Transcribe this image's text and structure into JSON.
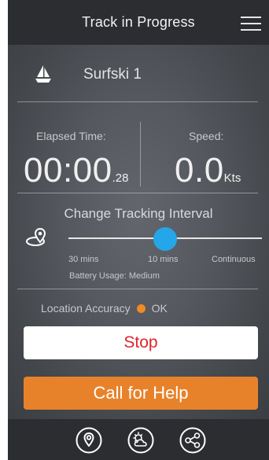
{
  "header": {
    "title": "Track in Progress",
    "menu_icon": "hamburger-menu-icon"
  },
  "boat": {
    "icon": "sailboat-icon",
    "name": "Surfski 1"
  },
  "stats": {
    "elapsed": {
      "label": "Elapsed Time:",
      "main": "00:00",
      "small": ".28"
    },
    "speed": {
      "label": "Speed:",
      "main": "0.0",
      "unit": "Kts"
    }
  },
  "interval": {
    "title": "Change Tracking Interval",
    "icon": "tracking-pin-icon",
    "options": [
      "30 mins",
      "10 mins",
      "Continuous"
    ],
    "selected": "10 mins",
    "position_fraction": 0.5,
    "battery_label": "Battery Usage: Medium"
  },
  "accuracy": {
    "label": "Location Accuracy",
    "status": "OK",
    "status_color": "#f08a24"
  },
  "buttons": {
    "stop": "Stop",
    "help": "Call for Help"
  },
  "colors": {
    "accent": "#25a6e8",
    "stop_text": "#e0242b",
    "help_bg": "#e8822a"
  },
  "bottom_nav": {
    "icons": [
      "location-pin-icon",
      "weather-icon",
      "share-icon"
    ]
  }
}
